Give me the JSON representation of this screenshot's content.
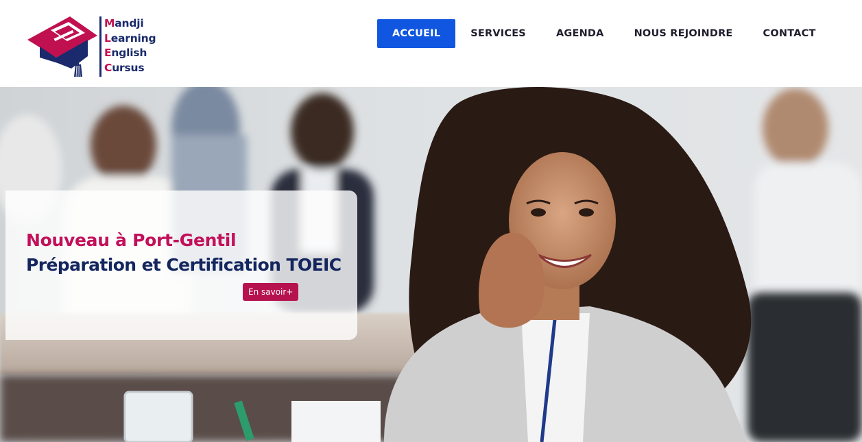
{
  "brand": {
    "lines": [
      {
        "initial": "M",
        "rest": "andji"
      },
      {
        "initial": "L",
        "rest": "earning"
      },
      {
        "initial": "E",
        "rest": "nglish"
      },
      {
        "initial": "C",
        "rest": "ursus"
      }
    ],
    "colors": {
      "navy": "#1a2a6c",
      "magenta": "#c0104f"
    }
  },
  "nav": {
    "items": [
      {
        "label": "ACCUEIL",
        "active": true
      },
      {
        "label": "SERVICES",
        "active": false
      },
      {
        "label": "AGENDA",
        "active": false
      },
      {
        "label": "NOUS REJOINDRE",
        "active": false
      },
      {
        "label": "CONTACT",
        "active": false
      }
    ],
    "active_color": "#1156e0"
  },
  "hero": {
    "line1": "Nouveau à Port-Gentil",
    "line2": "Préparation et Certification TOEIC",
    "button_label": "En savoir+",
    "colors": {
      "line1": "#c2105a",
      "line2": "#14265e",
      "button": "#b5124f"
    }
  }
}
